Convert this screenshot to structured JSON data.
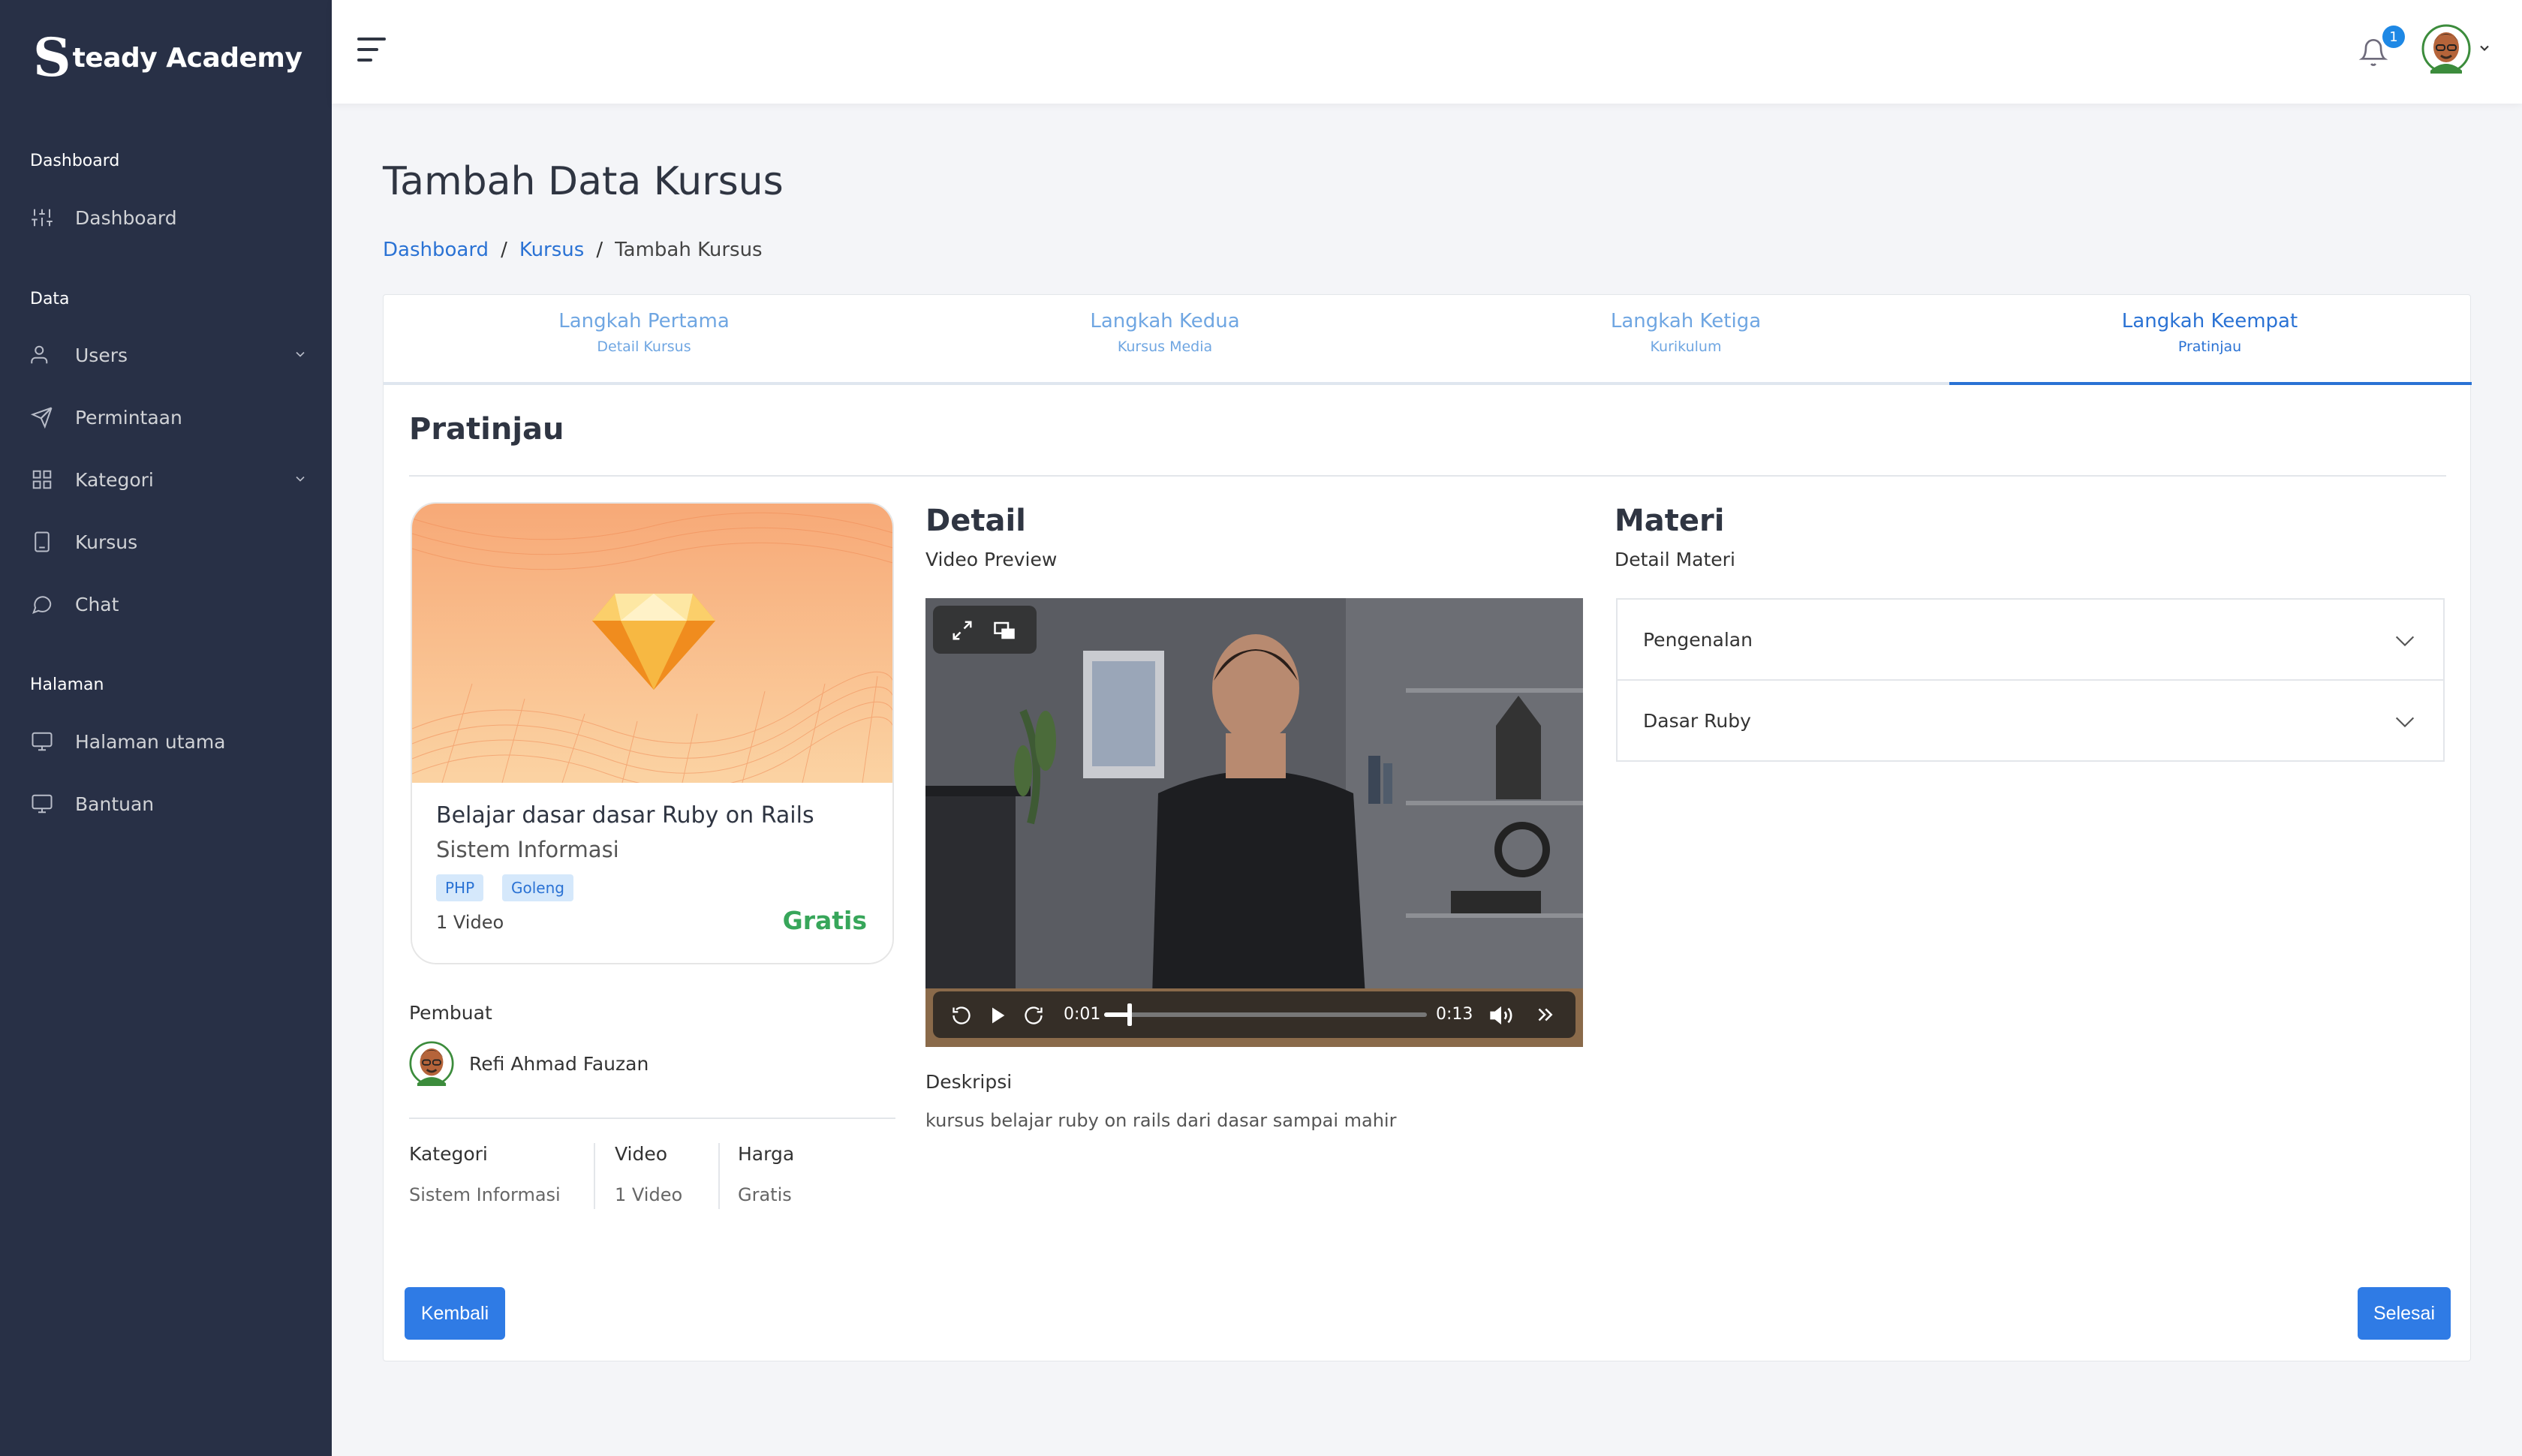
{
  "brand": {
    "logo_letter": "S",
    "name": "teady Academy"
  },
  "sidebar": {
    "sections": [
      {
        "label": "Dashboard",
        "items": [
          {
            "label": "Dashboard",
            "icon": "sliders-icon"
          }
        ]
      },
      {
        "label": "Data",
        "items": [
          {
            "label": "Users",
            "icon": "user-icon",
            "has_submenu": true
          },
          {
            "label": "Permintaan",
            "icon": "send-icon"
          },
          {
            "label": "Kategori",
            "icon": "grid-icon",
            "has_submenu": true
          },
          {
            "label": "Kursus",
            "icon": "book-icon"
          },
          {
            "label": "Chat",
            "icon": "chat-icon"
          }
        ]
      },
      {
        "label": "Halaman",
        "items": [
          {
            "label": "Halaman utama",
            "icon": "monitor-icon"
          },
          {
            "label": "Bantuan",
            "icon": "monitor-icon"
          }
        ]
      }
    ]
  },
  "topbar": {
    "notification_count": "1"
  },
  "page": {
    "title": "Tambah Data Kursus"
  },
  "breadcrumb": {
    "items": [
      "Dashboard",
      "Kursus",
      "Tambah Kursus"
    ]
  },
  "stepper": {
    "steps": [
      {
        "title": "Langkah Pertama",
        "subtitle": "Detail Kursus"
      },
      {
        "title": "Langkah Kedua",
        "subtitle": "Kursus Media"
      },
      {
        "title": "Langkah Ketiga",
        "subtitle": "Kurikulum"
      },
      {
        "title": "Langkah Keempat",
        "subtitle": "Pratinjau"
      }
    ],
    "active_step": 4
  },
  "preview": {
    "heading": "Pratinjau",
    "course_card": {
      "title": "Belajar dasar dasar Ruby on Rails",
      "category": "Sistem Informasi",
      "tags": [
        "PHP",
        "Goleng"
      ],
      "video_count": "1 Video",
      "price": "Gratis"
    },
    "creator": {
      "label": "Pembuat",
      "name": "Refi Ahmad Fauzan"
    },
    "meta": [
      {
        "label": "Kategori",
        "value": "Sistem Informasi"
      },
      {
        "label": "Video",
        "value": "1 Video"
      },
      {
        "label": "Harga",
        "value": "Gratis"
      }
    ]
  },
  "detail": {
    "heading": "Detail",
    "video_label": "Video Preview",
    "video": {
      "current_time": "0:01",
      "duration": "0:13",
      "progress": 0.08
    },
    "description_label": "Deskripsi",
    "description": "kursus belajar ruby on rails dari dasar sampai mahir"
  },
  "materi": {
    "heading": "Materi",
    "sub": "Detail Materi",
    "items": [
      "Pengenalan",
      "Dasar Ruby"
    ]
  },
  "buttons": {
    "back": "Kembali",
    "finish": "Selesai"
  },
  "colors": {
    "sidebar_bg": "#283046",
    "primary": "#2f7be5",
    "price_green": "#37a65a"
  }
}
